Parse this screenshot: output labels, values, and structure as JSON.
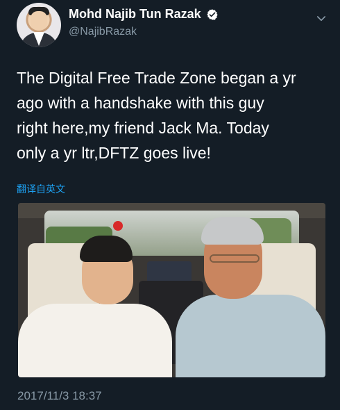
{
  "author": {
    "display_name": "Mohd Najib Tun Razak",
    "handle": "@NajibRazak"
  },
  "tweet": {
    "text": "The Digital Free Trade Zone began a yr\nago with a handshake with this guy\nright here,my friend Jack Ma. Today\nonly a yr ltr,DFTZ goes live!",
    "translate_label": "翻译自英文",
    "timestamp": "2017/11/3 18:37"
  },
  "icons": {
    "verified": "verified-badge-icon",
    "menu": "chevron-down-icon"
  },
  "colors": {
    "background": "#141d26",
    "text": "#ffffff",
    "secondary": "#8899a6",
    "link": "#1da1f2"
  }
}
